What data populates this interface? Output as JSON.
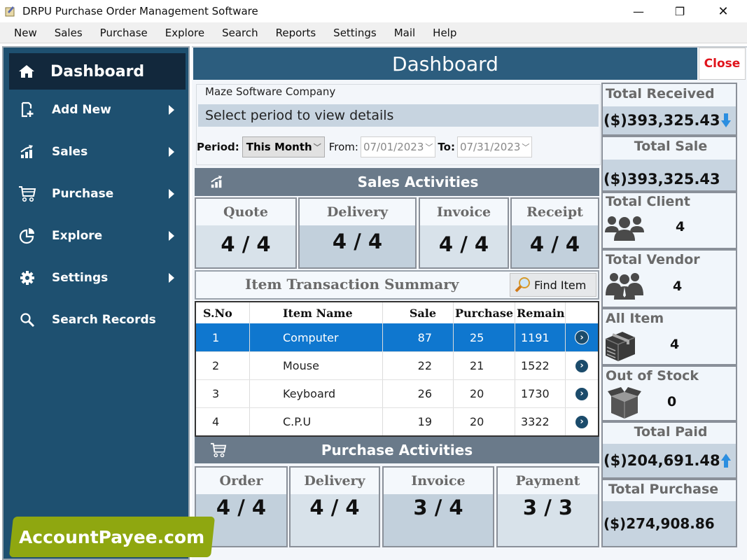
{
  "window": {
    "title": "DRPU Purchase Order Management Software",
    "controls": {
      "minimize": "—",
      "restore": "❐",
      "close": "✕"
    }
  },
  "menu": [
    "New",
    "Sales",
    "Purchase",
    "Explore",
    "Search",
    "Reports",
    "Settings",
    "Mail",
    "Help"
  ],
  "sidebar": {
    "active": {
      "label": "Dashboard",
      "icon": "home-icon"
    },
    "items": [
      {
        "label": "Add New",
        "icon": "add-document-icon",
        "submenu": true
      },
      {
        "label": "Sales",
        "icon": "sales-chart-icon",
        "submenu": true
      },
      {
        "label": "Purchase",
        "icon": "cart-icon",
        "submenu": true
      },
      {
        "label": "Explore",
        "icon": "pie-chart-icon",
        "submenu": true
      },
      {
        "label": "Settings",
        "icon": "gear-icon",
        "submenu": true
      },
      {
        "label": "Search Records",
        "icon": "search-icon",
        "submenu": false
      }
    ]
  },
  "header": {
    "title": "Dashboard",
    "close_label": "Close"
  },
  "company": {
    "name": "Maze Software Company",
    "hint": "Select period to view details",
    "period_label": "Period:",
    "period_value": "This Month",
    "from_label": "From:",
    "from_value": "07/01/2023",
    "to_label": "To:",
    "to_value": "07/31/2023"
  },
  "sales_activities": {
    "title": "Sales Activities",
    "tiles": [
      {
        "label": "Quote",
        "value": "4 / 4"
      },
      {
        "label": "Delivery",
        "value": "4 / 4"
      },
      {
        "label": "Invoice",
        "value": "4 / 4"
      },
      {
        "label": "Receipt",
        "value": "4 / 4"
      }
    ]
  },
  "item_summary": {
    "title": "Item Transaction Summary",
    "find_label": "Find Item",
    "columns": [
      "S.No",
      "Item Name",
      "Sale",
      "Purchase",
      "Remain"
    ],
    "rows": [
      {
        "sno": "1",
        "name": "Computer",
        "sale": "87",
        "purchase": "25",
        "remain": "1191"
      },
      {
        "sno": "2",
        "name": "Mouse",
        "sale": "22",
        "purchase": "21",
        "remain": "1522"
      },
      {
        "sno": "3",
        "name": "Keyboard",
        "sale": "26",
        "purchase": "20",
        "remain": "1730"
      },
      {
        "sno": "4",
        "name": "C.P.U",
        "sale": "19",
        "purchase": "20",
        "remain": "3322"
      }
    ],
    "selected_row": 0
  },
  "purchase_activities": {
    "title": "Purchase Activities",
    "tiles": [
      {
        "label": "Order",
        "value": "4 / 4"
      },
      {
        "label": "Delivery",
        "value": "4 / 4"
      },
      {
        "label": "Invoice",
        "value": "3 / 4"
      },
      {
        "label": "Payment",
        "value": "3 / 3"
      }
    ]
  },
  "summary": {
    "total_received": {
      "label": "Total Received",
      "value": "($)393,325.43",
      "trend": "down"
    },
    "total_sale": {
      "label": "Total Sale",
      "value": "($)393,325.43"
    },
    "total_client": {
      "label": "Total Client",
      "value": "4"
    },
    "total_vendor": {
      "label": "Total Vendor",
      "value": "4"
    },
    "all_item": {
      "label": "All Item",
      "value": "4"
    },
    "out_of_stock": {
      "label": "Out of Stock",
      "value": "0"
    },
    "total_paid": {
      "label": "Total Paid",
      "value": "($)204,691.48",
      "trend": "up"
    },
    "total_purchase": {
      "label": "Total Purchase",
      "value": "($)274,908.86"
    }
  },
  "watermark": "AccountPayee.com",
  "colors": {
    "sidebar": "#1e5070",
    "header": "#2c5d7e",
    "selected_row": "#0f77cf",
    "close": "#e0141c",
    "watermark": "#8fa710"
  }
}
